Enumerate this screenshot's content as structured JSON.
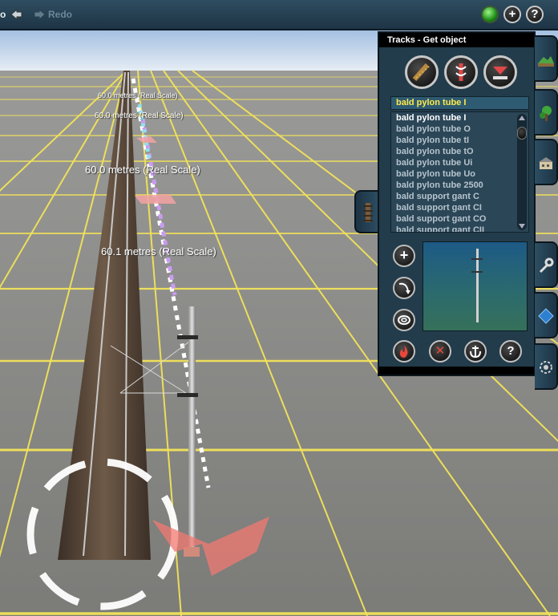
{
  "toolbar": {
    "undo_label": "o",
    "redo_label": "Redo"
  },
  "viewport": {
    "measurements": [
      "60.0 metres  (Real Scale)",
      "60.0 metres  (Real Scale)",
      "60.0 metres  (Real Scale)",
      "60.1 metres  (Real Scale)"
    ]
  },
  "panel": {
    "title": "Tracks - Get object",
    "selected_object": "bald pylon tube I",
    "objects": [
      "bald pylon tube I",
      "bald pylon tube O",
      "bald pylon tube tI",
      "bald pylon tube tO",
      "bald pylon tube Ui",
      "bald pylon tube Uo",
      "bald pylon tube 2500",
      "bald support gant C",
      "bald support gant CI",
      "bald support gant CO",
      "bald support gant CII"
    ],
    "selected_index": 0
  },
  "icons": {
    "add": "+",
    "help": "?",
    "cancel": "✕"
  },
  "colors": {
    "panel_bg": "#233c4b",
    "selected_text": "#ffe94a",
    "grid_line": "#f2e35a",
    "ground": "#8a8a86"
  }
}
